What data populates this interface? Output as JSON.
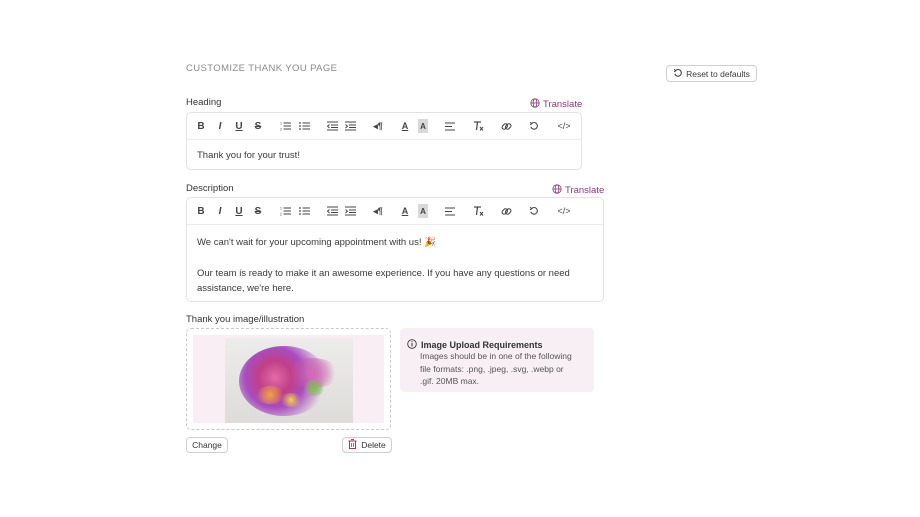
{
  "page": {
    "section_title": "CUSTOMIZE THANK YOU PAGE",
    "reset_label": "Reset to defaults"
  },
  "heading": {
    "label": "Heading",
    "translate_label": "Translate",
    "value": "Thank you for your trust!"
  },
  "description": {
    "label": "Description",
    "translate_label": "Translate",
    "line1": "We can't wait for your upcoming appointment with us! 🎉",
    "line2": "Our team is ready to make it an awesome experience. If you have any questions or need",
    "line3": "assistance, we're here."
  },
  "toolbar": {
    "bold": "B",
    "italic": "I",
    "underline": "U",
    "strike": "S",
    "rtl": "◂¶",
    "font_color": "A",
    "bg_color": "A",
    "code": "</>"
  },
  "image": {
    "label": "Thank you image/illustration",
    "change_label": "Change",
    "delete_label": "Delete"
  },
  "requirements": {
    "title": "Image Upload Requirements",
    "line1": "Images should be in one of the following",
    "line2": "file formats: .png, .jpeg, .svg, .webp or",
    "line3": ".gif. 20MB max."
  },
  "colors": {
    "accent": "#8b3b7e",
    "info_bg": "#f7eff3",
    "delete_icon": "#b0306b"
  }
}
